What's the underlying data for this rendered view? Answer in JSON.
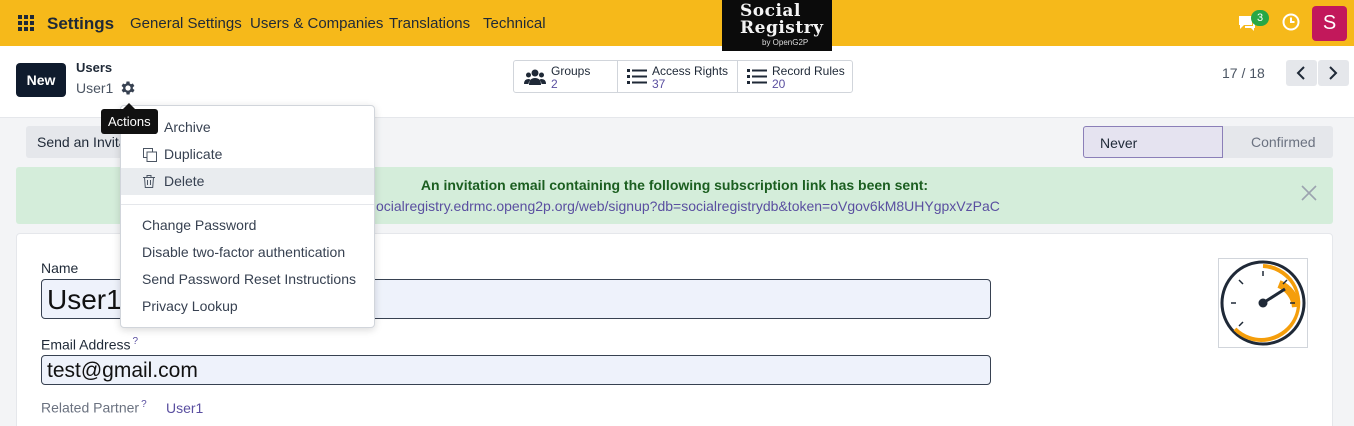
{
  "navbar": {
    "brand": "Settings",
    "menu": [
      "General Settings",
      "Users & Companies",
      "Translations",
      "Technical"
    ],
    "logo": {
      "line1": "Social",
      "line2": "Registry",
      "line3": "by OpenG2P"
    },
    "chat_badge": "3",
    "avatar_letter": "S",
    "color": "#f6b91a"
  },
  "control": {
    "new_label": "New",
    "breadcrumb_parent": "Users",
    "breadcrumb_current": "User1",
    "tooltip": "Actions",
    "stats": [
      {
        "label": "Groups",
        "value": "2"
      },
      {
        "label": "Access Rights",
        "value": "37"
      },
      {
        "label": "Record Rules",
        "value": "20"
      }
    ],
    "pager": "17 / 18"
  },
  "form": {
    "invite_label": "Send an Invitation Email",
    "status": [
      "Never Connected",
      "Confirmed"
    ],
    "alert_title": "An invitation email containing the following subscription link has been sent:",
    "alert_link": "ocialregistry.edrmc.openg2p.org/web/signup?db=socialregistrydb&token=oVgov6kM8UHYgpxVzPaC",
    "name_label": "Name",
    "name_value": "User1",
    "email_label": "Email Address",
    "email_value": "test@gmail.com",
    "related_label": "Related Partner",
    "related_value": "User1",
    "help_mark": "?"
  },
  "actions_menu": {
    "items": [
      "Archive",
      "Duplicate",
      "Delete"
    ],
    "extra": [
      "Change Password",
      "Disable two-factor authentication",
      "Send Password Reset Instructions",
      "Privacy Lookup"
    ]
  }
}
